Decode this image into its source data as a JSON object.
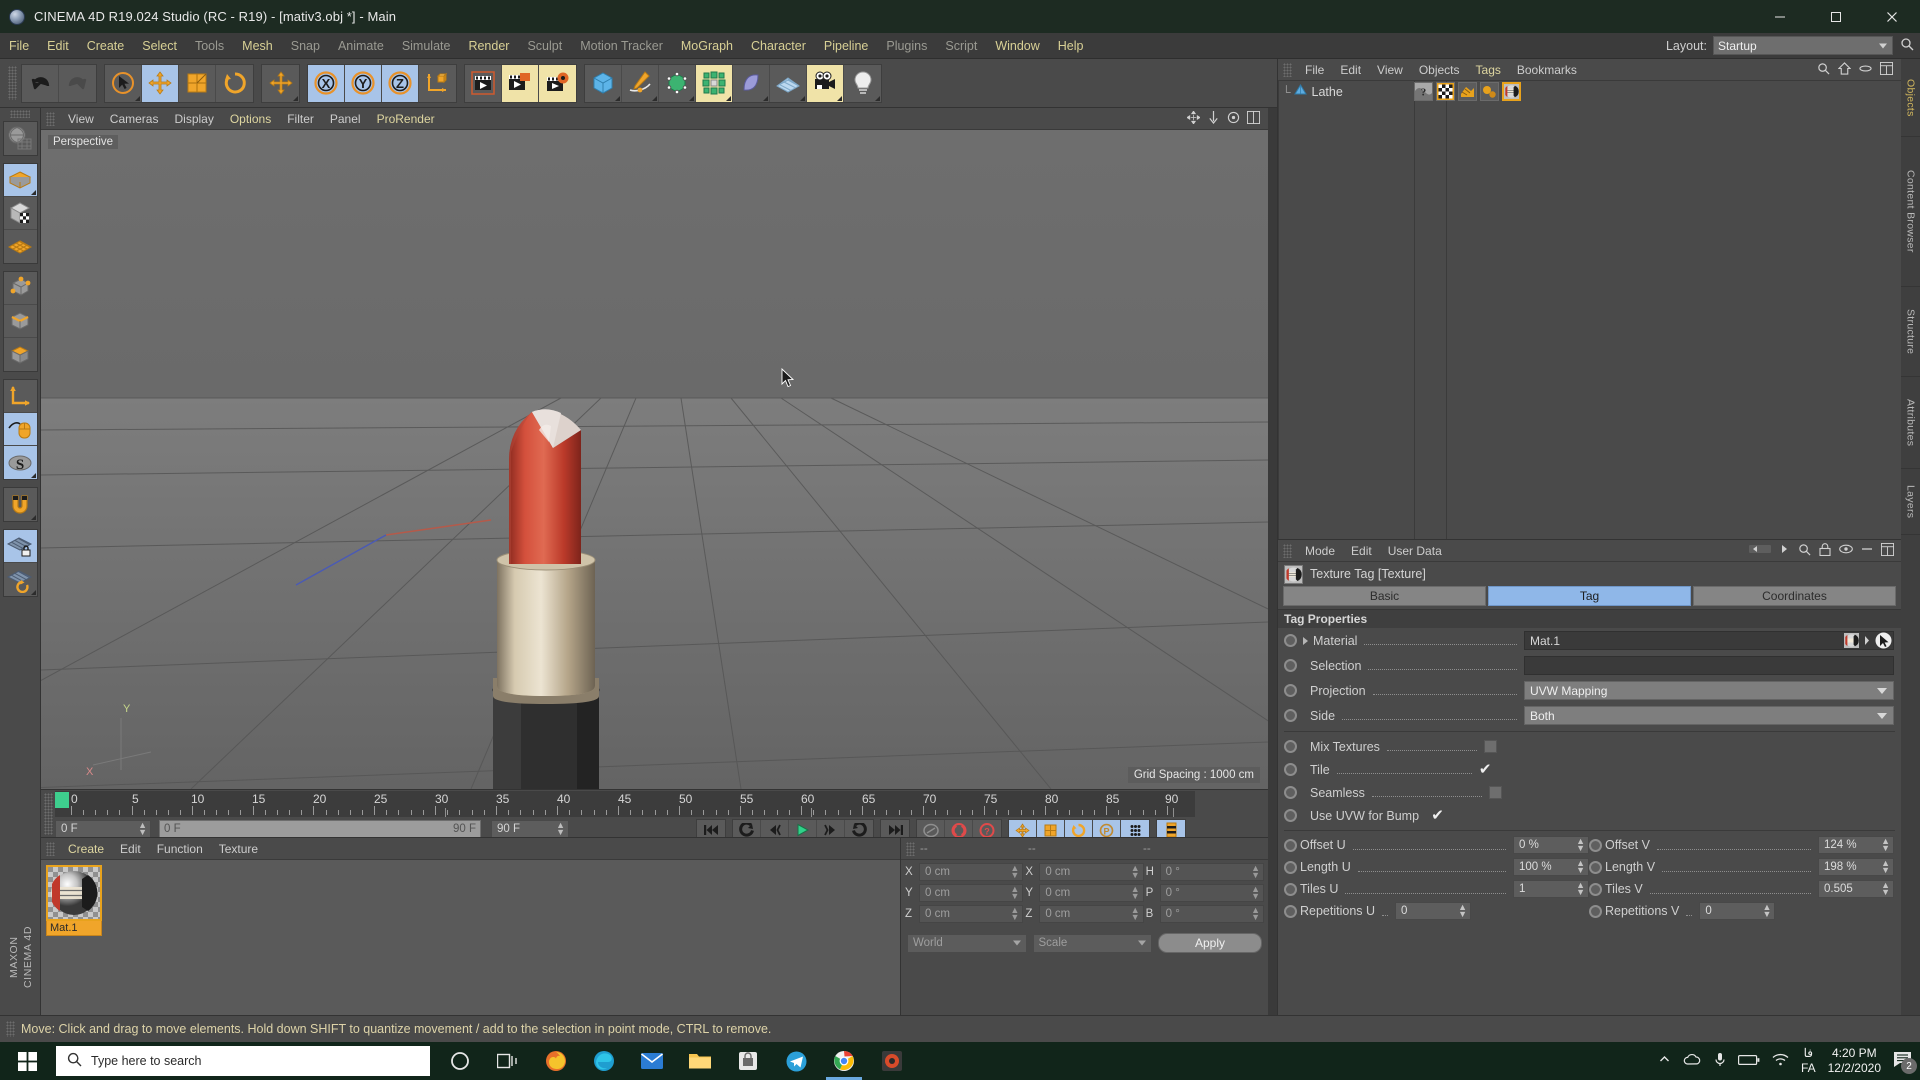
{
  "window": {
    "title": "CINEMA 4D R19.024 Studio (RC - R19) - [mativ3.obj *] - Main",
    "minimize": "–",
    "maximize": "❐",
    "close": "✕"
  },
  "menubar": {
    "items": [
      {
        "label": "File",
        "dim": false
      },
      {
        "label": "Edit",
        "dim": false
      },
      {
        "label": "Create",
        "dim": false
      },
      {
        "label": "Select",
        "dim": false
      },
      {
        "label": "Tools",
        "dim": true
      },
      {
        "label": "Mesh",
        "dim": false
      },
      {
        "label": "Snap",
        "dim": true
      },
      {
        "label": "Animate",
        "dim": true
      },
      {
        "label": "Simulate",
        "dim": true
      },
      {
        "label": "Render",
        "dim": false
      },
      {
        "label": "Sculpt",
        "dim": true
      },
      {
        "label": "Motion Tracker",
        "dim": true
      },
      {
        "label": "MoGraph",
        "dim": false
      },
      {
        "label": "Character",
        "dim": false
      },
      {
        "label": "Pipeline",
        "dim": false
      },
      {
        "label": "Plugins",
        "dim": true
      },
      {
        "label": "Script",
        "dim": true
      },
      {
        "label": "Window",
        "dim": false
      },
      {
        "label": "Help",
        "dim": false
      }
    ],
    "layout_label": "Layout:",
    "layout_value": "Startup"
  },
  "viewport": {
    "menus": [
      {
        "label": "View",
        "hl": false
      },
      {
        "label": "Cameras",
        "hl": false
      },
      {
        "label": "Display",
        "hl": false
      },
      {
        "label": "Options",
        "hl": true
      },
      {
        "label": "Filter",
        "hl": false
      },
      {
        "label": "Panel",
        "hl": false
      },
      {
        "label": "ProRender",
        "hl": true
      }
    ],
    "view_name": "Perspective",
    "grid_spacing": "Grid Spacing : 1000 cm",
    "axis_x": "X",
    "axis_y": "Y"
  },
  "timeline": {
    "ruler_ticks": [
      "0",
      "5",
      "10",
      "15",
      "20",
      "25",
      "30",
      "35",
      "40",
      "45",
      "50",
      "55",
      "60",
      "65",
      "70",
      "75",
      "80",
      "85",
      "90"
    ],
    "current_frame": "0 F",
    "range_start": "0 F",
    "range_end": "90 F",
    "end_frame": "90 F",
    "preview_frame": "0 F"
  },
  "material_manager": {
    "menus": [
      {
        "label": "Create",
        "hl": true
      },
      {
        "label": "Edit",
        "hl": false
      },
      {
        "label": "Function",
        "hl": false
      },
      {
        "label": "Texture",
        "hl": false
      }
    ],
    "materials": [
      {
        "name": "Mat.1",
        "selected": true
      }
    ]
  },
  "coordinates": {
    "col_headers": [
      "--",
      "--",
      "--"
    ],
    "rows": [
      {
        "ax1": "X",
        "v1": "0 cm",
        "ax2": "X",
        "v2": "0 cm",
        "ax3": "H",
        "v3": "0 °"
      },
      {
        "ax1": "Y",
        "v1": "0 cm",
        "ax2": "Y",
        "v2": "0 cm",
        "ax3": "P",
        "v3": "0 °"
      },
      {
        "ax1": "Z",
        "v1": "0 cm",
        "ax2": "Z",
        "v2": "0 cm",
        "ax3": "B",
        "v3": "0 °"
      }
    ],
    "system": "World",
    "mode": "Scale",
    "apply": "Apply"
  },
  "object_manager": {
    "menus": [
      {
        "label": "File",
        "hl": false
      },
      {
        "label": "Edit",
        "hl": false
      },
      {
        "label": "View",
        "hl": false
      },
      {
        "label": "Objects",
        "hl": false
      },
      {
        "label": "Tags",
        "hl": true
      },
      {
        "label": "Bookmarks",
        "hl": false
      }
    ],
    "objects": [
      {
        "name": "Lathe",
        "selected": false
      }
    ],
    "tag_icons": [
      "phong-tag-icon",
      "uvw-tag-icon",
      "texture-restriction-icon",
      "dots-tag-icon",
      "texture-tag-icon"
    ],
    "header_icons": [
      "search-icon",
      "home-icon",
      "ellipse-icon",
      "layout-icon"
    ]
  },
  "attributes": {
    "menus": [
      {
        "label": "Mode",
        "hl": false
      },
      {
        "label": "Edit",
        "hl": false
      },
      {
        "label": "User Data",
        "hl": false
      }
    ],
    "header_icons": [
      "back-arrow-icon",
      "forward-arrow-icon",
      "search-icon",
      "lock-icon",
      "eye-icon",
      "minus-icon",
      "layout-icon"
    ],
    "object_title": "Texture Tag [Texture]",
    "tabs": [
      {
        "label": "Basic",
        "active": false
      },
      {
        "label": "Tag",
        "active": true
      },
      {
        "label": "Coordinates",
        "active": false
      }
    ],
    "section_title": "Tag Properties",
    "properties": [
      {
        "label": "Material",
        "type": "link",
        "value": "Mat.1",
        "expandable": true
      },
      {
        "label": "Selection",
        "type": "text",
        "value": ""
      },
      {
        "label": "Projection",
        "type": "dropdown",
        "value": "UVW Mapping"
      },
      {
        "label": "Side",
        "type": "dropdown",
        "value": "Both"
      }
    ],
    "checkboxes": [
      {
        "label": "Mix Textures",
        "checked": false
      },
      {
        "label": "Tile",
        "checked": true
      },
      {
        "label": "Seamless",
        "checked": false
      },
      {
        "label": "Use UVW for Bump",
        "checked": true
      }
    ],
    "numeric_pairs": [
      {
        "l1": "Offset U",
        "v1": "0 %",
        "l2": "Offset V",
        "v2": "124 %"
      },
      {
        "l1": "Length U",
        "v1": "100 %",
        "l2": "Length V",
        "v2": "198 %"
      },
      {
        "l1": "Tiles U",
        "v1": "1",
        "l2": "Tiles V",
        "v2": "0.505"
      },
      {
        "l1": "Repetitions U",
        "v1": "0",
        "l2": "Repetitions V",
        "v2": "0"
      }
    ]
  },
  "right_tabs": [
    {
      "label": "Objects",
      "dim": false
    },
    {
      "label": "Content Browser",
      "dim": true
    },
    {
      "label": "Structure",
      "dim": true
    },
    {
      "label": "Attributes",
      "dim": true
    },
    {
      "label": "Layers",
      "dim": true
    }
  ],
  "left_brand": "MAXON\nCINEMA 4D",
  "statusbar": {
    "message": "Move: Click and drag to move elements. Hold down SHIFT to quantize movement / add to the selection in point mode, CTRL to remove."
  },
  "taskbar": {
    "search_placeholder": "Type here to search",
    "time": "4:20 PM",
    "date": "12/2/2020",
    "lang_top": "فا",
    "lang_bottom": "FA",
    "notification_count": "2"
  },
  "colors": {
    "accent_orange": "#f0a52a",
    "accent_blue": "#a8c4e8",
    "menu_yellow": "#d8d095",
    "panel_bg": "#4a4a4a",
    "viewport_bg": "#6d6d6d",
    "lipstick_red": "#c0392b",
    "lipstick_gold": "#c9b79a",
    "lipstick_black": "#2d2d2d"
  }
}
